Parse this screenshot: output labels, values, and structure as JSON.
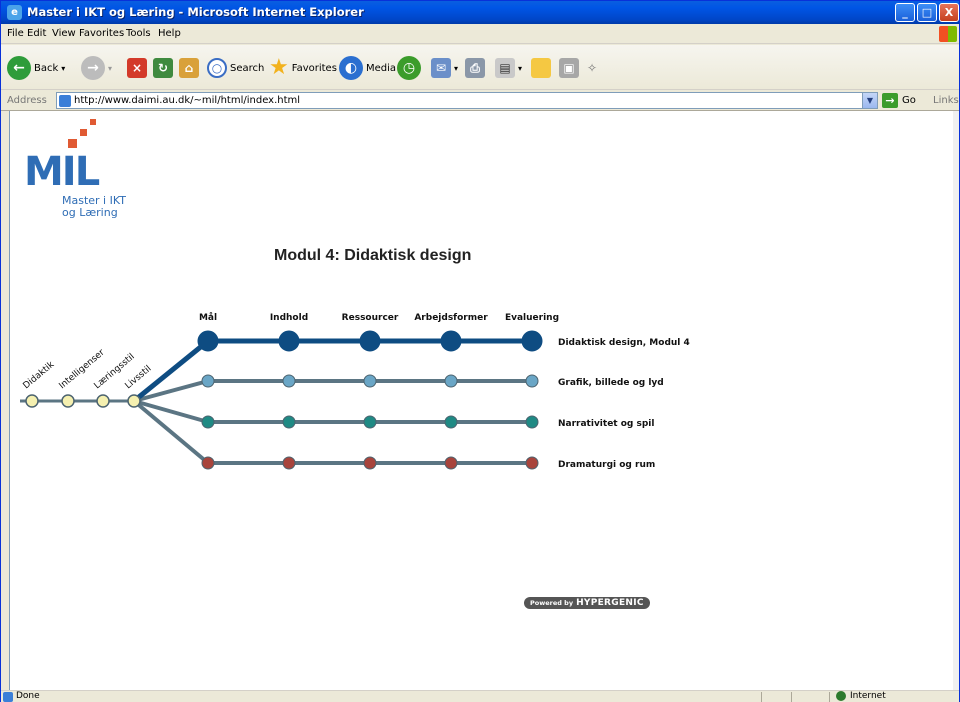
{
  "window": {
    "title": "Master i IKT og Læring - Microsoft Internet Explorer",
    "min_label": "_",
    "max_label": "□",
    "close_label": "X"
  },
  "menu": [
    "File",
    "Edit",
    "View",
    "Favorites",
    "Tools",
    "Help"
  ],
  "toolbar": {
    "back": "Back",
    "search": "Search",
    "favorites": "Favorites",
    "media": "Media"
  },
  "address": {
    "label": "Address",
    "url": "http://www.daimi.au.dk/~mil/html/index.html",
    "go": "Go",
    "links": "Links"
  },
  "page": {
    "logo_mark": "MIL",
    "logo_line1": "Master i IKT",
    "logo_line2": "og Læring",
    "title": "Modul 4: Didaktisk design",
    "powered_prefix": "Powered by",
    "powered_brand": "HYPERGENIC"
  },
  "diagram": {
    "left_stations": [
      "Didaktik",
      "Intelligenser",
      "Læringsstil",
      "Livsstil"
    ],
    "columns": [
      "Mål",
      "Indhold",
      "Ressourcer",
      "Arbejdsformer",
      "Evaluering"
    ],
    "lines": [
      {
        "label": "Didaktisk design, Modul 4",
        "color": "#0e4c82"
      },
      {
        "label": "Grafik, billede og lyd",
        "color": "#6aa6c6"
      },
      {
        "label": "Narrativitet og spil",
        "color": "#1f8a84"
      },
      {
        "label": "Dramaturgi og rum",
        "color": "#a8443c"
      }
    ],
    "trunk_color": "#5b7583",
    "station_fill": "#f5f0b0"
  },
  "status": {
    "text": "Done",
    "zone": "Internet"
  }
}
